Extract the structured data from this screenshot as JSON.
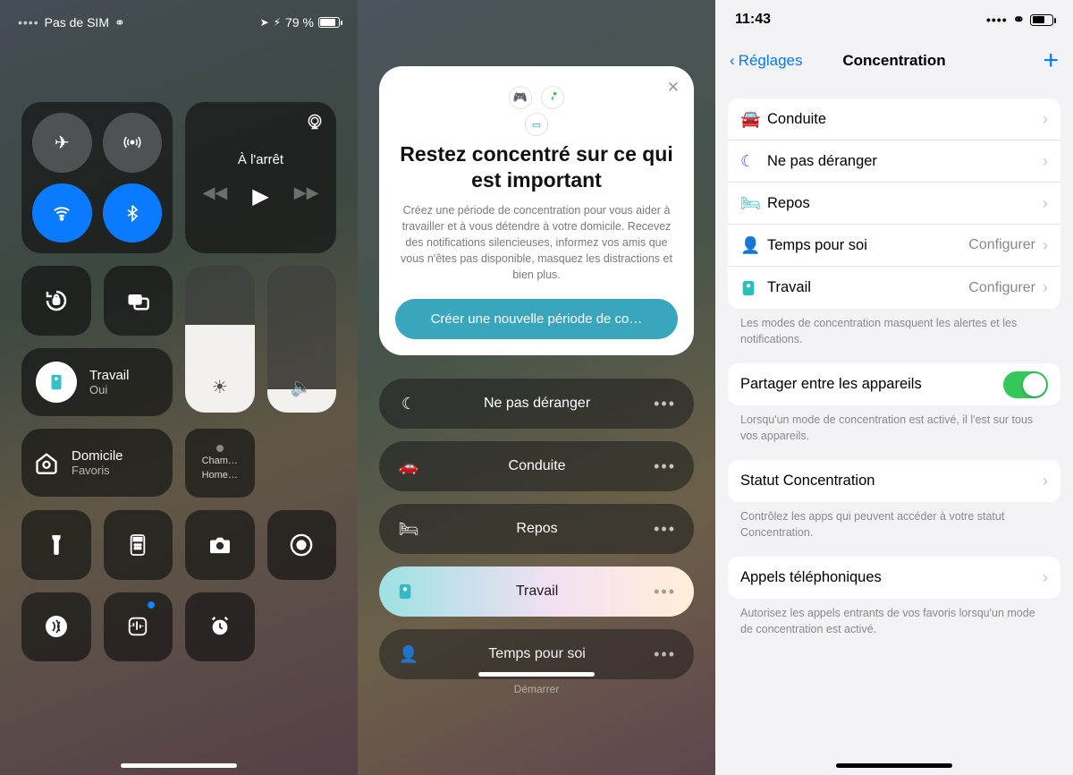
{
  "panel1": {
    "status": {
      "carrier": "Pas de SIM",
      "battery_pct": "79 %"
    },
    "media": {
      "title": "À l'arrêt"
    },
    "focus": {
      "name": "Travail",
      "state": "Oui"
    },
    "home": {
      "name": "Domicile",
      "sub": "Favoris"
    },
    "room_tile": {
      "line1": "Cham…",
      "line2": "Home…"
    }
  },
  "panel2": {
    "card": {
      "heading": "Restez concentré sur ce qui est important",
      "desc": "Créez une période de concentration pour vous aider à travailler et à vous détendre à votre domicile. Recevez des notifications silencieuses, informez vos amis que vous n'êtes pas disponible, masquez les distractions et bien plus.",
      "cta": "Créer une nouvelle période de co…"
    },
    "list": {
      "dnd": "Ne pas déranger",
      "driving": "Conduite",
      "sleep": "Repos",
      "work": "Travail",
      "personal": "Temps pour soi",
      "start_hint": "Démarrer"
    }
  },
  "panel3": {
    "status_time": "11:43",
    "nav": {
      "back": "Réglages",
      "title": "Concentration"
    },
    "modes": {
      "driving": {
        "label": "Conduite"
      },
      "dnd": {
        "label": "Ne pas déranger"
      },
      "sleep": {
        "label": "Repos"
      },
      "personal": {
        "label": "Temps pour soi",
        "detail": "Configurer"
      },
      "work": {
        "label": "Travail",
        "detail": "Configurer"
      }
    },
    "modes_caption": "Les modes de concentration masquent les alertes et les notifications.",
    "share": {
      "label": "Partager entre les appareils",
      "caption": "Lorsqu'un mode de concentration est activé, il l'est sur tous vos appareils."
    },
    "status_row": {
      "label": "Statut Concentration",
      "caption": "Contrôlez les apps qui peuvent accéder à votre statut Concentration."
    },
    "calls": {
      "label": "Appels téléphoniques",
      "caption": "Autorisez les appels entrants de vos favoris lorsqu'un mode de concentration est activé."
    }
  }
}
